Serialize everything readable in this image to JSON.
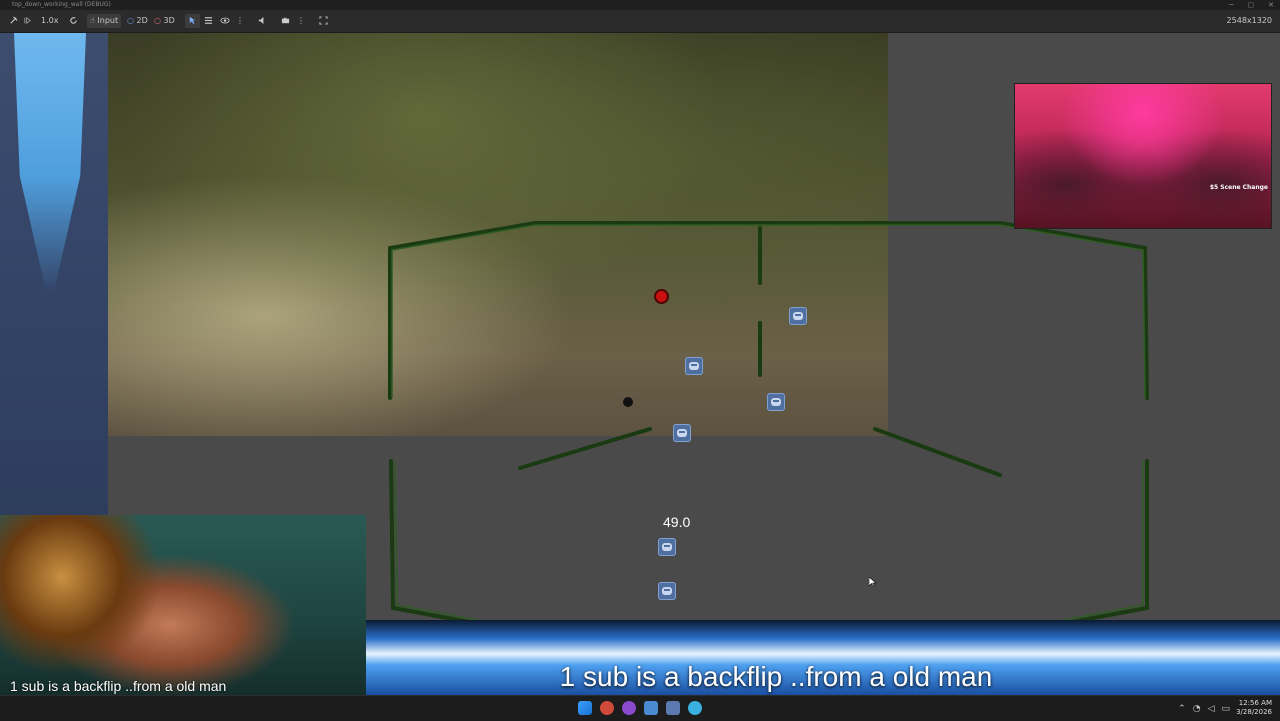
{
  "window": {
    "title": "top_down_working_wall (DEBUG)"
  },
  "toolbar": {
    "zoom": "1.0x",
    "input_label": "Input",
    "mode_2d": "2D",
    "mode_3d": "3D",
    "resolution": "2548x1320"
  },
  "game": {
    "value_label": "49.0"
  },
  "stream": {
    "left_caption": "1 sub is a backflip ..from a old man",
    "main_caption": "1 sub is a backflip ..from a old man",
    "right_overlay": "$5 Scene Change"
  },
  "taskbar": {
    "time": "12:56 AM",
    "date": "3/28/2026"
  },
  "colors": {
    "wall": "#1a3a12",
    "accent": "#4f9fdd",
    "background": "#4a4a4a"
  }
}
